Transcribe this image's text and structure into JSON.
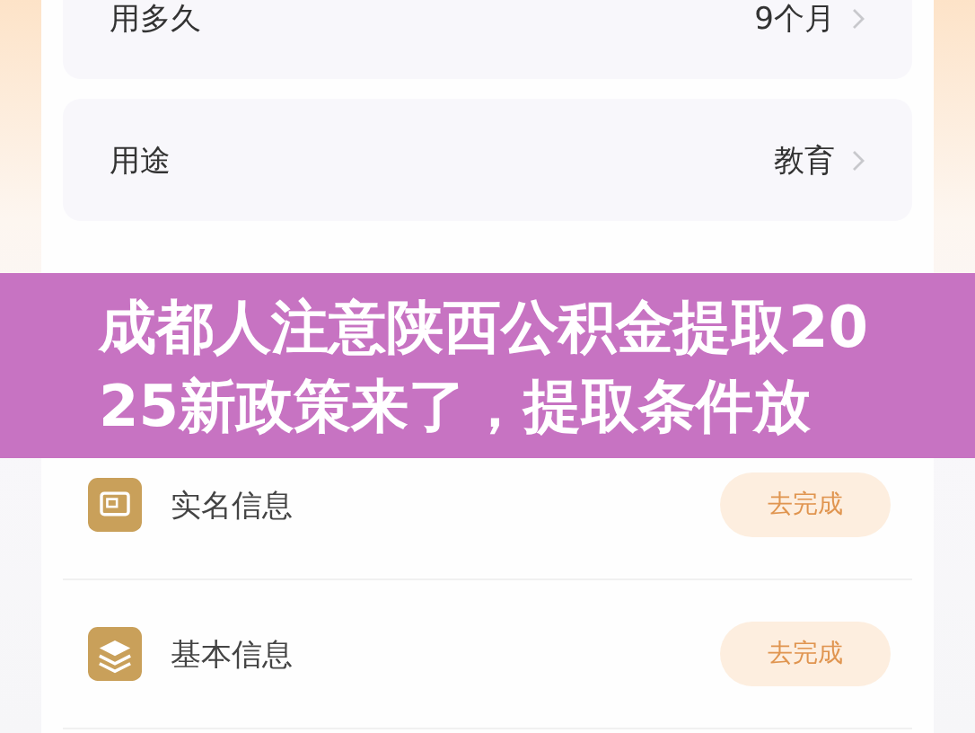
{
  "fields": [
    {
      "label": "用多久",
      "value": "9个月"
    },
    {
      "label": "用途",
      "value": "教育"
    }
  ],
  "banner": {
    "title": "成都人注意陕西公积金提取2025新政策来了，提取条件放"
  },
  "tasks": [
    {
      "kind": "id-card",
      "label": "实名信息",
      "action": "去完成"
    },
    {
      "kind": "layers",
      "label": "基本信息",
      "action": "去完成"
    }
  ]
}
